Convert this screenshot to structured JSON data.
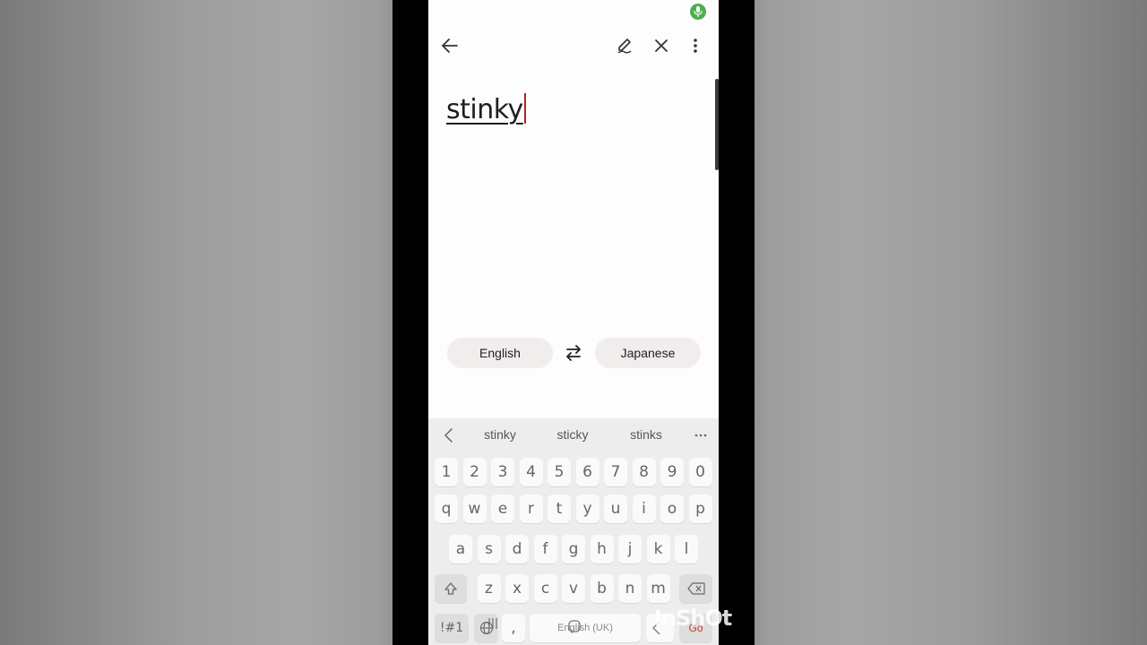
{
  "app": {
    "input_text": "stinky",
    "source_language": "English",
    "target_language": "Japanese"
  },
  "keyboard": {
    "suggestions": [
      "stinky",
      "sticky",
      "stinks"
    ],
    "rows": [
      [
        "1",
        "2",
        "3",
        "4",
        "5",
        "6",
        "7",
        "8",
        "9",
        "0"
      ],
      [
        "q",
        "w",
        "e",
        "r",
        "t",
        "y",
        "u",
        "i",
        "o",
        "p"
      ],
      [
        "a",
        "s",
        "d",
        "f",
        "g",
        "h",
        "j",
        "k",
        "l"
      ],
      [
        "z",
        "x",
        "c",
        "v",
        "b",
        "n",
        "m"
      ]
    ],
    "symbols_key": "!#1",
    "comma_key": ",",
    "space_label": "English (UK)",
    "go_label": "Go"
  },
  "watermark": "InShOt",
  "colors": {
    "accent_mic": "#4caf50",
    "caret": "#b3261e",
    "pill_bg": "#f2eded",
    "keyboard_bg": "#ededed"
  },
  "icons": [
    "back-arrow-icon",
    "handwriting-icon",
    "close-icon",
    "more-vert-icon",
    "swap-languages-icon",
    "mic-icon",
    "backspace-icon",
    "shift-icon",
    "globe-icon"
  ]
}
